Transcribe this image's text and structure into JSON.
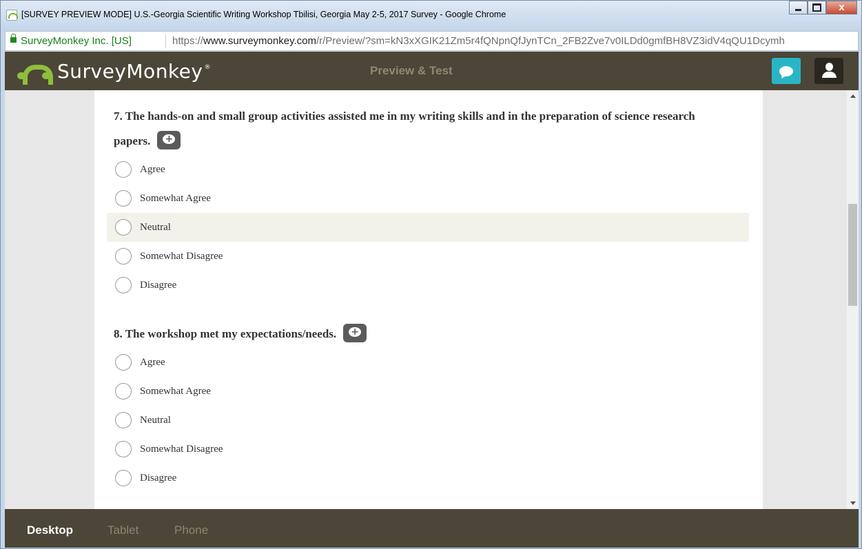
{
  "window": {
    "title": "[SURVEY PREVIEW MODE] U.S.-Georgia Scientific Writing Workshop Tbilisi, Georgia May 2-5, 2017 Survey - Google Chrome",
    "close_label": "X"
  },
  "address_bar": {
    "site_name": "SurveyMonkey Inc. [US]",
    "url_scheme": "https://",
    "url_host": "www.surveymonkey.com",
    "url_path": "/r/Preview/?sm=kN3xXGIK21Zm5r4fQNpnQfJynTCn_2FB2Zve7v0ILDd0gmfBH8VZ3idV4qQU1Dcymh"
  },
  "header": {
    "logo_text": "SurveyMonkey",
    "logo_reg": "®",
    "center_title": "Preview & Test",
    "brand_color": "#4b4638",
    "chat_color": "#2ab5c6"
  },
  "questions": [
    {
      "title": "7. The hands-on and small group activities assisted me in my writing skills and in the preparation of science research papers.",
      "options": [
        "Agree",
        "Somewhat Agree",
        "Neutral",
        "Somewhat Disagree",
        "Disagree"
      ],
      "hovered_option": "Neutral"
    },
    {
      "title": "8. The workshop met my expectations/needs.",
      "options": [
        "Agree",
        "Somewhat Agree",
        "Neutral",
        "Somewhat Disagree",
        "Disagree"
      ]
    }
  ],
  "device_bar": {
    "tabs": [
      "Desktop",
      "Tablet",
      "Phone"
    ],
    "active": "Desktop"
  }
}
